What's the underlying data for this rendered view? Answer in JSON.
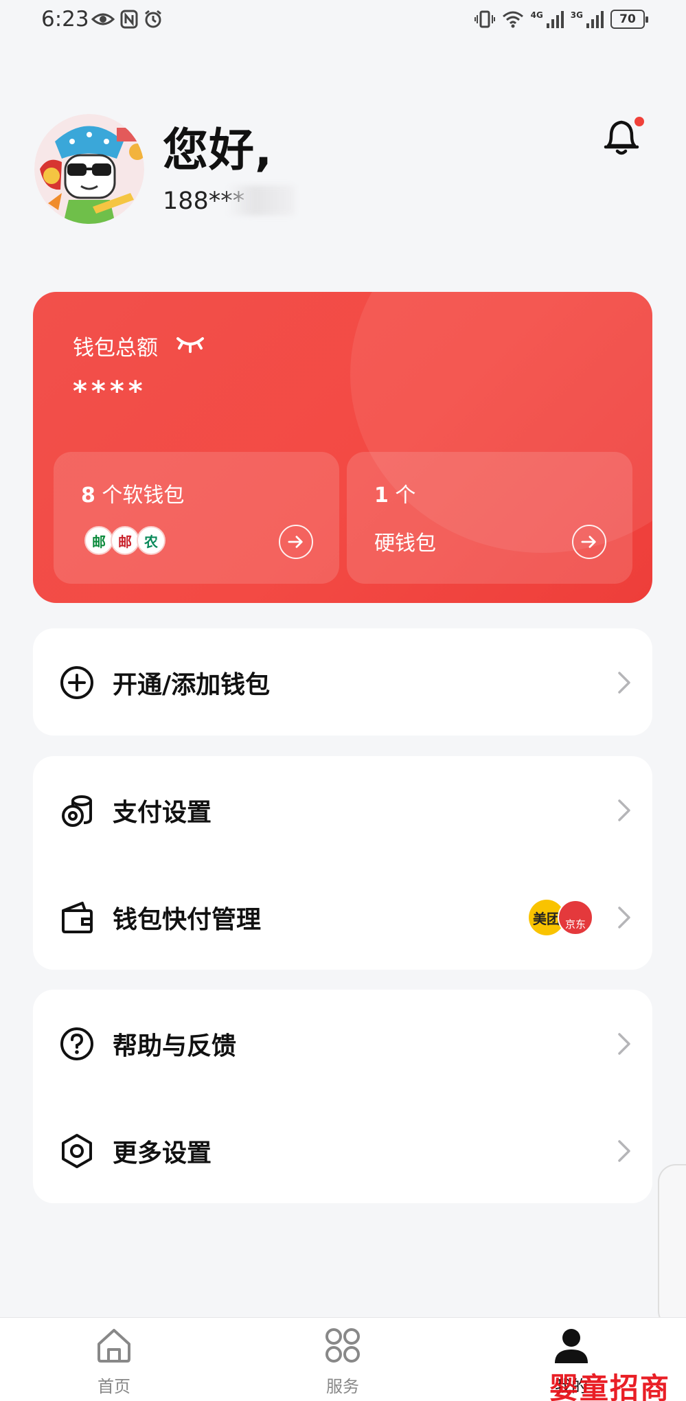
{
  "status_bar": {
    "time": "6:23",
    "left_icons": [
      "eye-icon",
      "nfc-icon",
      "alarm-icon"
    ],
    "network_1": "4G",
    "network_2": "3G",
    "battery": "70"
  },
  "header": {
    "greeting": "您好,",
    "phone": "188***",
    "notification_dot_color": "#f0413a"
  },
  "wallet": {
    "title": "钱包总额",
    "amount": "****",
    "soft_wallet": {
      "count": "8",
      "label": "个软钱包",
      "bank_icons": [
        "邮",
        "邮",
        "农"
      ]
    },
    "hard_wallet": {
      "count": "1",
      "unit": "个",
      "caption": "硬钱包"
    },
    "card_color": "#f34a44"
  },
  "menu": {
    "open_wallet": "开通/添加钱包",
    "pay_settings": "支付设置",
    "quick_pay": "钱包快付管理",
    "merchant_logos": [
      "美团",
      "京东"
    ],
    "help": "帮助与反馈",
    "more_settings": "更多设置"
  },
  "bottom_nav": {
    "home": "首页",
    "service": "服务",
    "mine": "我的"
  },
  "watermark": "婴童招商网"
}
